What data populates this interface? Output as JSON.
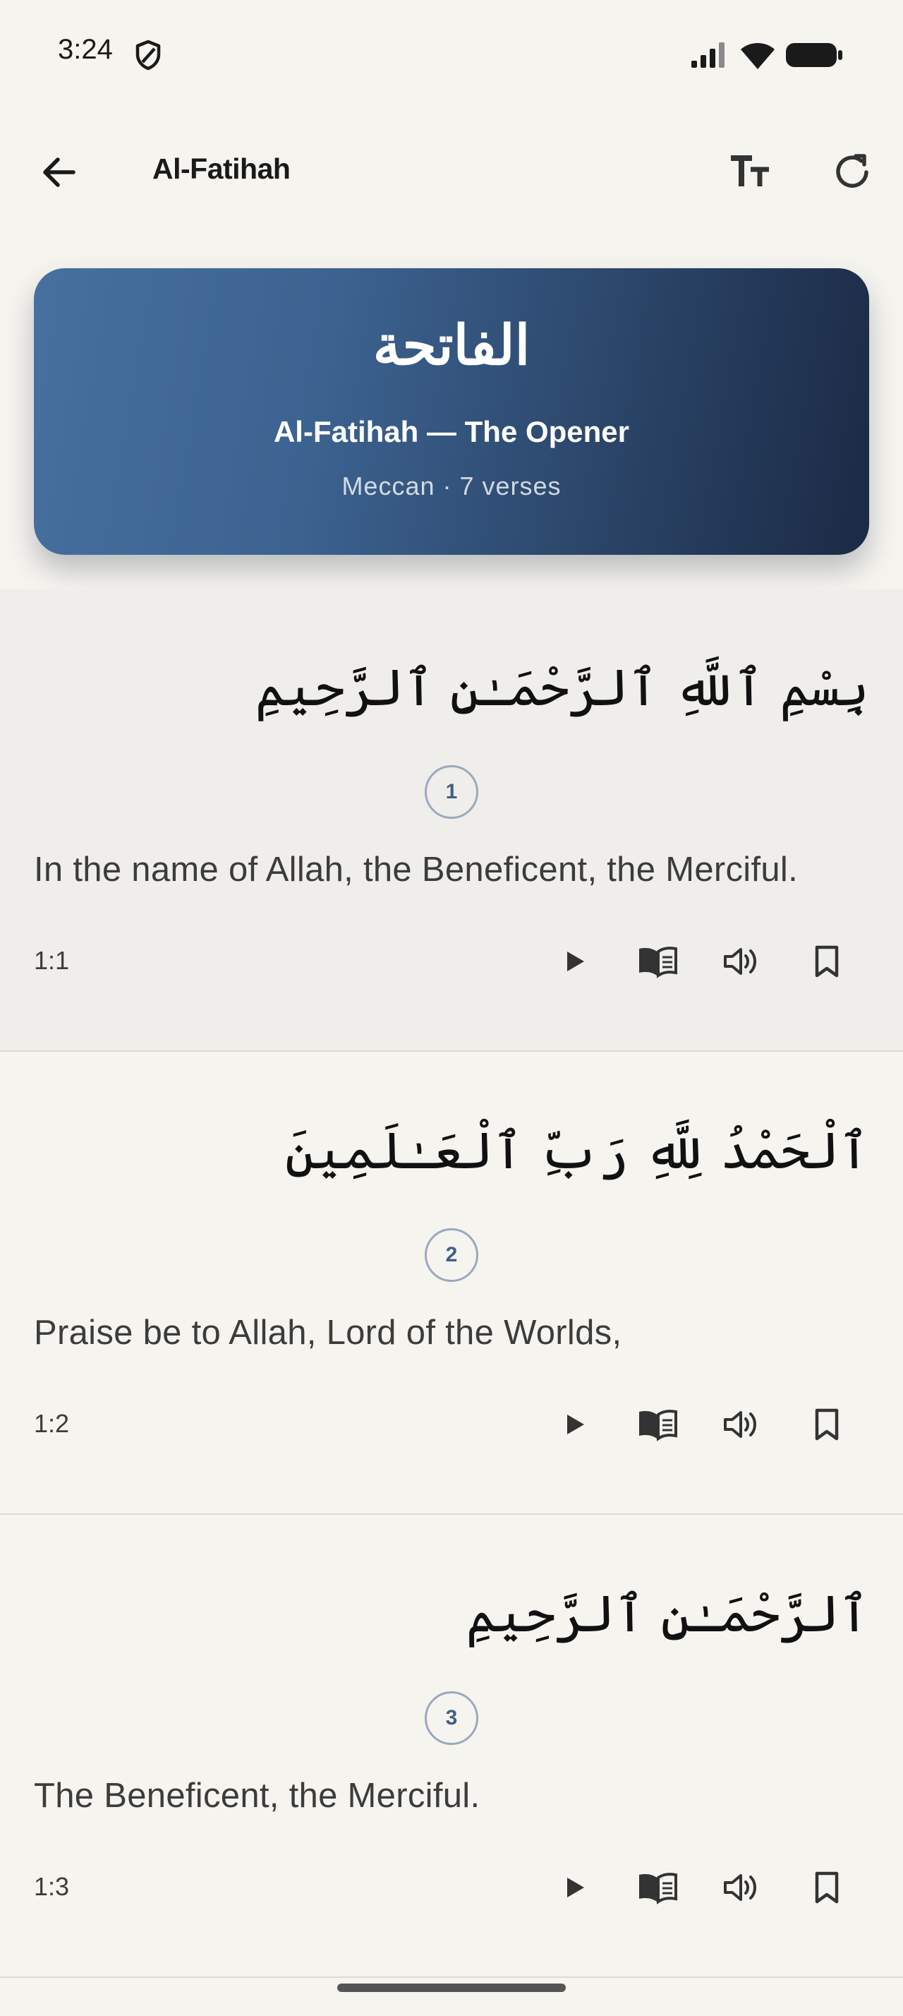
{
  "status_bar": {
    "time": "3:24"
  },
  "app_bar": {
    "title": "Al-Fatihah"
  },
  "header": {
    "arabic_name": "الفاتحة",
    "name": "Al-Fatihah — The Opener",
    "meta": "Meccan · 7 verses"
  },
  "verses": [
    {
      "number": "1",
      "arabic": "بِسْمِ ٱللَّهِ ٱلرَّحْمَـٰنِ ٱلرَّحِيمِ",
      "translation": "In the name of Allah, the Beneficent, the Merciful.",
      "ref": "1:1",
      "highlighted": true
    },
    {
      "number": "2",
      "arabic": "ٱلْحَمْدُ لِلَّهِ رَبِّ ٱلْعَـٰلَمِينَ",
      "translation": "Praise be to Allah, Lord of the Worlds,",
      "ref": "1:2",
      "highlighted": false
    },
    {
      "number": "3",
      "arabic": "ٱلرَّحْمَـٰنِ ٱلرَّحِيمِ",
      "translation": "The Beneficent, the Merciful.",
      "ref": "1:3",
      "highlighted": false
    }
  ],
  "icons": {
    "back": "arrow-left-icon",
    "text_size": "text-size-icon",
    "refresh": "refresh-icon",
    "play": "play-icon",
    "tafsir": "open-book-icon",
    "audio": "speaker-icon",
    "bookmark": "bookmark-icon"
  },
  "colors": {
    "card_gradient_start": "#47709f",
    "card_gradient_end": "#1b2a45",
    "background": "#f6f4ef",
    "highlight_row": "#efeeeb",
    "badge_text": "#3f5f87"
  }
}
